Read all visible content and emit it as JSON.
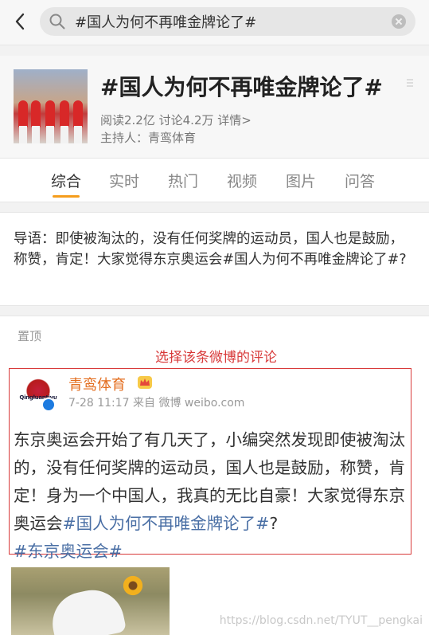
{
  "search": {
    "query": "#国人为何不再唯金牌论了#"
  },
  "topic": {
    "title": "#国人为何不再唯金牌论了#",
    "reads": "阅读2.2亿",
    "discussions": "讨论4.2万",
    "detail_link": "详情>",
    "host": "主持人：青鸾体育"
  },
  "tabs": [
    {
      "label": "综合",
      "active": true
    },
    {
      "label": "实时",
      "active": false
    },
    {
      "label": "热门",
      "active": false
    },
    {
      "label": "视频",
      "active": false
    },
    {
      "label": "图片",
      "active": false
    },
    {
      "label": "问答",
      "active": false
    }
  ],
  "intro": {
    "text": "导语：即使被淘汰的，没有任何奖牌的运动员，国人也是鼓励，称赞，肯定！大家觉得东京奥运会#国人为何不再唯金牌论了#?"
  },
  "pinned": {
    "label": "置顶",
    "annotation": "选择该条微博的评论"
  },
  "post": {
    "author": "青鸾体育",
    "avatar_text": "Qingluantiyu",
    "meta": "7-28 11:17 来自 微博 weibo.com",
    "text_prefix": "东京奥运会开始了有几天了，小编突然发现即使被淘汰的，没有任何奖牌的运动员，国人也是鼓励，称赞，肯定！身为一个中国人，我真的无比自豪！大家觉得东京奥运会",
    "hashtag1": "#国人为何不再唯金牌论了#",
    "text_mid": "?",
    "hashtag2": "#东京奥运会#"
  },
  "watermark": "https://blog.csdn.net/TYUT__pengkai",
  "colors": {
    "accent_orange": "#f59d1c",
    "author_orange": "#e36d1e",
    "annotation_red": "#d83a3a",
    "hashtag_blue": "#4a6fa5"
  }
}
